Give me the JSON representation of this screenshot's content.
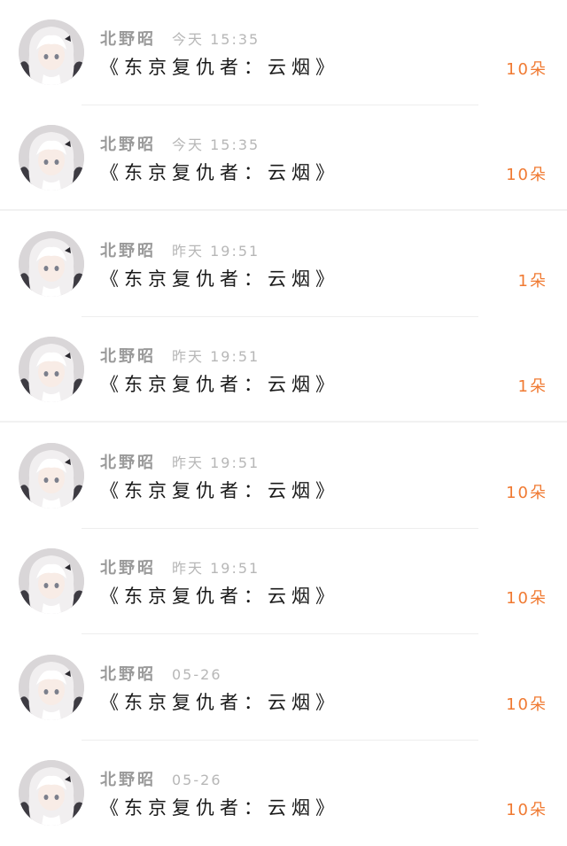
{
  "colors": {
    "accent": "#f07a32",
    "name": "#9a9a9a",
    "time": "#b7b7b7",
    "title": "#1a1a1a"
  },
  "items": [
    {
      "name": "北野昭",
      "time": "今天 15:35",
      "title": "《东京复仇者：云烟》",
      "count": "10朵",
      "avatar_icon": "anime-girl-avatar"
    },
    {
      "name": "北野昭",
      "time": "今天 15:35",
      "title": "《东京复仇者：云烟》",
      "count": "10朵",
      "avatar_icon": "anime-girl-avatar"
    },
    {
      "name": "北野昭",
      "time": "昨天 19:51",
      "title": "《东京复仇者：云烟》",
      "count": "1朵",
      "avatar_icon": "anime-girl-avatar"
    },
    {
      "name": "北野昭",
      "time": "昨天 19:51",
      "title": "《东京复仇者：云烟》",
      "count": "1朵",
      "avatar_icon": "anime-girl-avatar"
    },
    {
      "name": "北野昭",
      "time": "昨天 19:51",
      "title": "《东京复仇者：云烟》",
      "count": "10朵",
      "avatar_icon": "anime-girl-avatar"
    },
    {
      "name": "北野昭",
      "time": "昨天 19:51",
      "title": "《东京复仇者：云烟》",
      "count": "10朵",
      "avatar_icon": "anime-girl-avatar"
    },
    {
      "name": "北野昭",
      "time": "05-26",
      "title": "《东京复仇者：云烟》",
      "count": "10朵",
      "avatar_icon": "anime-girl-avatar"
    },
    {
      "name": "北野昭",
      "time": "05-26",
      "title": "《东京复仇者：云烟》",
      "count": "10朵",
      "avatar_icon": "anime-girl-avatar"
    }
  ]
}
